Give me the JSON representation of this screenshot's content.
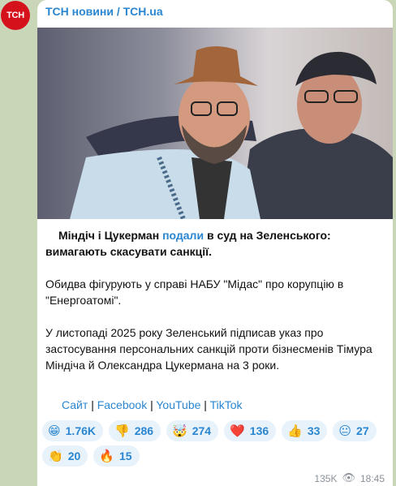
{
  "channel": {
    "avatar_text": "ТСН",
    "name": "ТСН новини / TCH.ua"
  },
  "post": {
    "lead_part1": "Міндіч і Цукерман ",
    "lead_link": "подали",
    "lead_part2": " в суд на Зеленського: вимагають скасувати санкції.",
    "paragraph2": "Обидва фігурують у справі НАБУ \"Мідас\" про корупцію в \"Енергоатомі\".",
    "paragraph3": "У листопаді 2025 року Зеленський підписав указ про застосування персональних санкцій проти бізнесменів Тімура Міндіча й Олександра Цукермана на 3 роки."
  },
  "links": {
    "site": "Сайт",
    "facebook": "Facebook",
    "youtube": "YouTube",
    "tiktok": "TikTok",
    "separator": "|"
  },
  "reactions": [
    {
      "emoji": "😁",
      "icon": "grin-icon",
      "count": "1.76K"
    },
    {
      "emoji": "👎",
      "icon": "thumbs-down-icon",
      "count": "286"
    },
    {
      "emoji": "🤯",
      "icon": "mind-blown-icon",
      "count": "274"
    },
    {
      "emoji": "❤️",
      "icon": "heart-icon",
      "count": "136"
    },
    {
      "emoji": "👍",
      "icon": "thumbs-up-icon",
      "count": "33"
    },
    {
      "emoji": "😐",
      "icon": "neutral-face-icon",
      "count": "27"
    },
    {
      "emoji": "👏",
      "icon": "clap-icon",
      "count": "20"
    },
    {
      "emoji": "🔥",
      "icon": "fire-icon",
      "count": "15"
    }
  ],
  "meta": {
    "views": "135K",
    "time": "18:45"
  },
  "colors": {
    "accent": "#2a86d0",
    "avatar_bg": "#d5121b",
    "chat_bg": "#c9d6b8"
  }
}
